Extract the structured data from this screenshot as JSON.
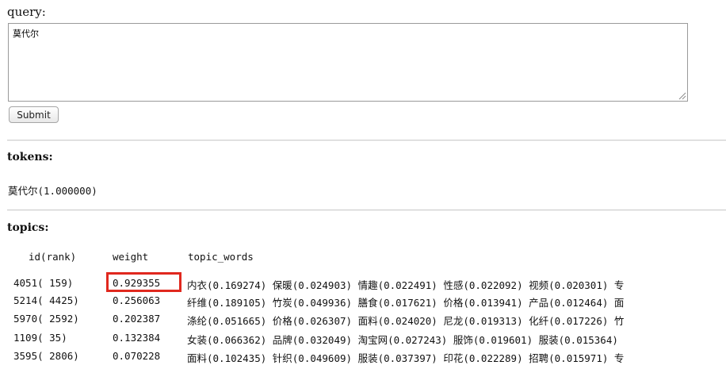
{
  "query": {
    "label": "query:",
    "value": "莫代尔",
    "submit_label": "Submit"
  },
  "tokens": {
    "heading": "tokens:",
    "line": "莫代尔(1.000000)"
  },
  "topics": {
    "heading": "topics:",
    "columns": [
      "id(rank)",
      "weight",
      "topic_words"
    ],
    "rows": [
      {
        "id_rank": "4051(  159)",
        "weight": "0.929355",
        "words": "内衣(0.169274) 保暖(0.024903) 情趣(0.022491) 性感(0.022092) 视频(0.020301) 专"
      },
      {
        "id_rank": "5214( 4425)",
        "weight": "0.256063",
        "words": "纤维(0.189105) 竹炭(0.049936) 膳食(0.017621) 价格(0.013941) 产品(0.012464) 面"
      },
      {
        "id_rank": "5970( 2592)",
        "weight": "0.202387",
        "words": "涤纶(0.051665) 价格(0.026307) 面料(0.024020) 尼龙(0.019313) 化纤(0.017226) 竹"
      },
      {
        "id_rank": "1109(   35)",
        "weight": "0.132384",
        "words": "女装(0.066362) 品牌(0.032049) 淘宝网(0.027243) 服饰(0.019601) 服装(0.015364)"
      },
      {
        "id_rank": "3595( 2806)",
        "weight": "0.070228",
        "words": "面料(0.102435) 针织(0.049609) 服装(0.037397) 印花(0.022289) 招聘(0.015971) 专"
      }
    ],
    "highlighted_weight": "0.929355",
    "highlight_color": "#e0281e"
  }
}
